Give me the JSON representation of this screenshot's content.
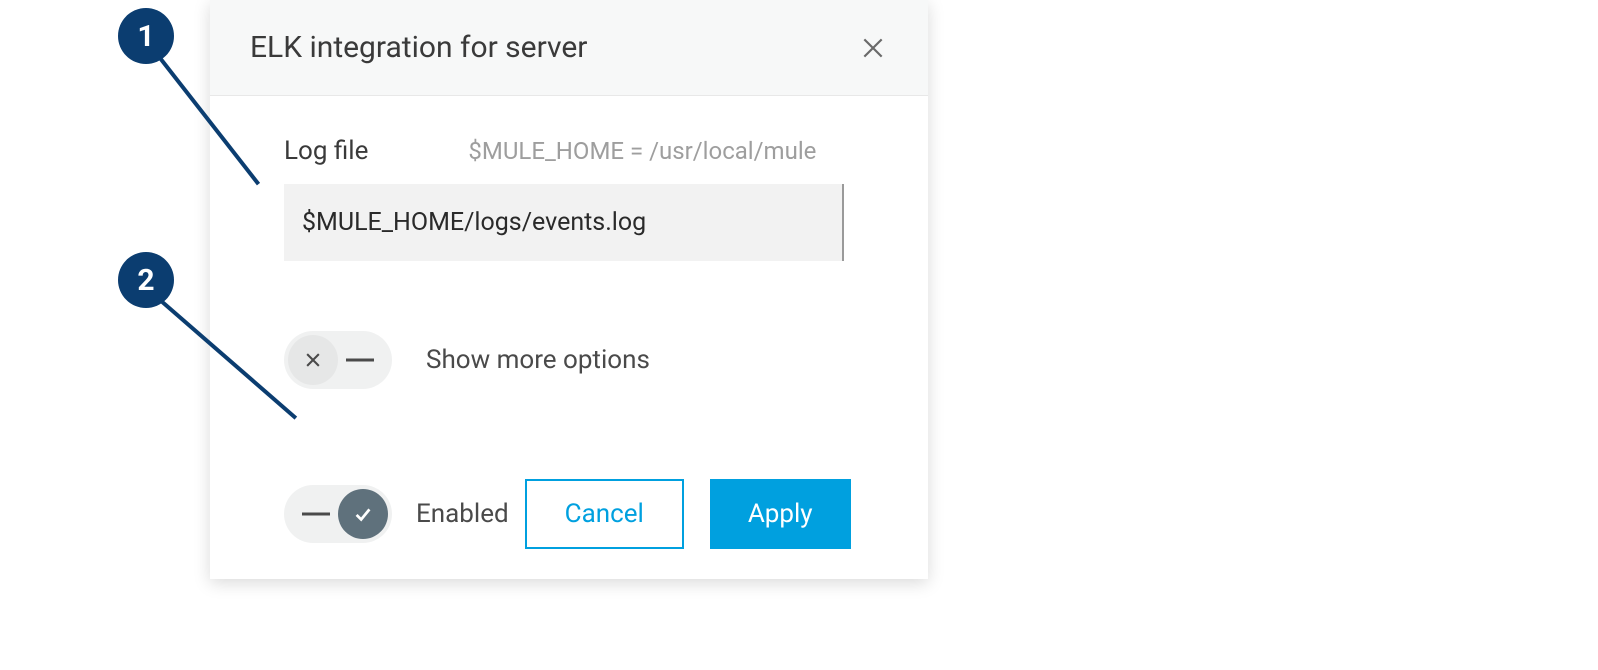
{
  "dialog": {
    "title": "ELK integration for server",
    "logfile_label": "Log file",
    "logfile_hint": "$MULE_HOME = /usr/local/mule",
    "logfile_value": "$MULE_HOME/logs/events.log",
    "more_options_label": "Show more options",
    "enabled_label": "Enabled",
    "cancel_label": "Cancel",
    "apply_label": "Apply"
  },
  "annotations": {
    "one": "1",
    "two": "2"
  },
  "colors": {
    "accent": "#00a0df",
    "callout": "#0b3d70"
  }
}
